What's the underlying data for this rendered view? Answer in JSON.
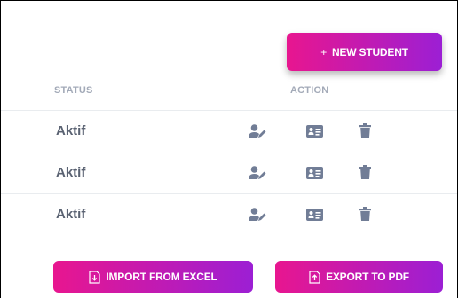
{
  "colors": {
    "gradient_start": "#e8168f",
    "gradient_end": "#9c1fd4",
    "header_text": "#a3aab8",
    "status_text": "#5a6272",
    "icon_color": "#717d96"
  },
  "toolbar": {
    "new_student_plus": "+",
    "new_student_label": "NEW STUDENT"
  },
  "table": {
    "headers": {
      "status": "STATUS",
      "action": "ACTION"
    },
    "rows": [
      {
        "status": "Aktif"
      },
      {
        "status": "Aktif"
      },
      {
        "status": "Aktif"
      }
    ],
    "action_icons": [
      "user-edit-icon",
      "id-card-icon",
      "trash-icon"
    ]
  },
  "footer": {
    "import_label": "IMPORT FROM EXCEL",
    "import_icon": "file-import-icon",
    "export_label": "EXPORT TO PDF",
    "export_icon": "file-export-icon"
  }
}
